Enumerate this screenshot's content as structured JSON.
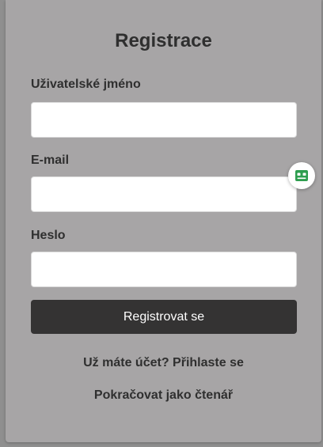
{
  "form": {
    "title": "Registrace",
    "fields": {
      "username": {
        "label": "Uživatelské jméno",
        "value": "",
        "placeholder": ""
      },
      "email": {
        "label": "E-mail",
        "value": "",
        "placeholder": ""
      },
      "password": {
        "label": "Heslo",
        "value": "",
        "placeholder": ""
      }
    },
    "submit_label": "Registrovat se",
    "login_link": "Už máte účet? Přihlaste se",
    "reader_link": "Pokračovat jako čtenář"
  },
  "colors": {
    "background": "#8f8f8f",
    "card": "#a7a5a6",
    "button": "#343333",
    "text": "#2f2f2f",
    "extension_icon": "#2e9e4f"
  },
  "icons": {
    "extension": "password-manager-icon"
  }
}
